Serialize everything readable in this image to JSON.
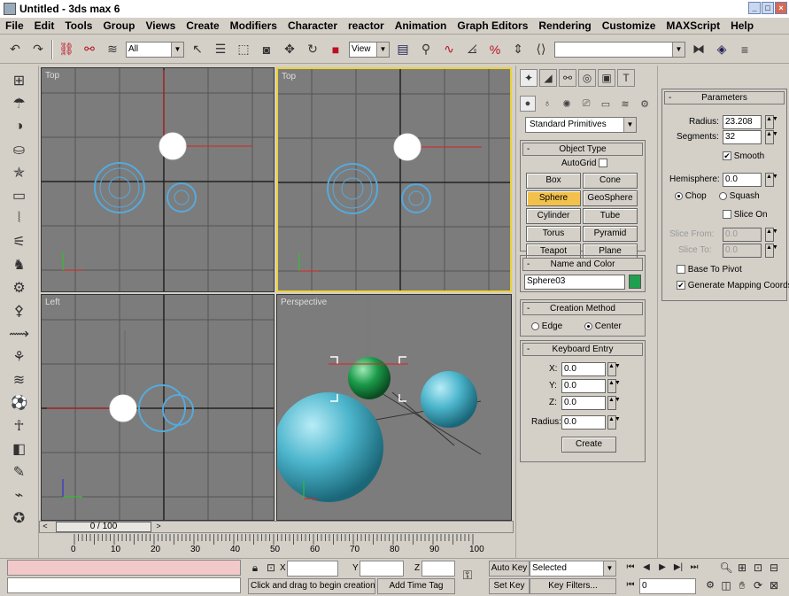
{
  "window": {
    "title": "Untitled - 3ds max 6"
  },
  "menu": [
    "File",
    "Edit",
    "Tools",
    "Group",
    "Views",
    "Create",
    "Modifiers",
    "Character",
    "reactor",
    "Animation",
    "Graph Editors",
    "Rendering",
    "Customize",
    "MAXScript",
    "Help"
  ],
  "toolbar": {
    "filter_value": "All",
    "refcoord_value": "View"
  },
  "viewports": {
    "top": "Top",
    "front": "Top",
    "left": "Left",
    "persp": "Perspective"
  },
  "timeline": {
    "frame": "0 / 100",
    "ticks": [
      "0",
      "10",
      "20",
      "30",
      "40",
      "50",
      "60",
      "70",
      "80",
      "90",
      "100"
    ]
  },
  "command_panel": {
    "category": "Standard Primitives",
    "object_type": {
      "title": "Object Type",
      "autogrid": "AutoGrid",
      "buttons": [
        "Box",
        "Cone",
        "Sphere",
        "GeoSphere",
        "Cylinder",
        "Tube",
        "Torus",
        "Pyramid",
        "Teapot",
        "Plane"
      ],
      "active": "Sphere"
    },
    "name_color": {
      "title": "Name and Color",
      "name": "Sphere03",
      "color": "#1fa050"
    },
    "creation_method": {
      "title": "Creation Method",
      "edge": "Edge",
      "center": "Center"
    },
    "keyboard_entry": {
      "title": "Keyboard Entry",
      "x_label": "X:",
      "y_label": "Y:",
      "z_label": "Z:",
      "x": "0.0",
      "y": "0.0",
      "z": "0.0",
      "radius_label": "Radius:",
      "radius": "0.0",
      "create": "Create"
    }
  },
  "parameters": {
    "title": "Parameters",
    "radius_label": "Radius:",
    "radius": "23.208",
    "segments_label": "Segments:",
    "segments": "32",
    "smooth": "Smooth",
    "hemisphere_label": "Hemisphere:",
    "hemisphere": "0.0",
    "chop": "Chop",
    "squash": "Squash",
    "slice_on": "Slice On",
    "slice_from_label": "Slice From:",
    "slice_from": "0.0",
    "slice_to_label": "Slice To:",
    "slice_to": "0.0",
    "base_to_pivot": "Base To Pivot",
    "gen_mapping": "Generate Mapping Coords."
  },
  "status": {
    "x_label": "X",
    "y_label": "Y",
    "z_label": "Z",
    "prompt": "Click and drag to begin creation p",
    "add_time_tag": "Add Time Tag",
    "auto_key": "Auto Key",
    "selected": "Selected",
    "set_key": "Set Key",
    "key_filters": "Key Filters...",
    "frame": "0"
  }
}
